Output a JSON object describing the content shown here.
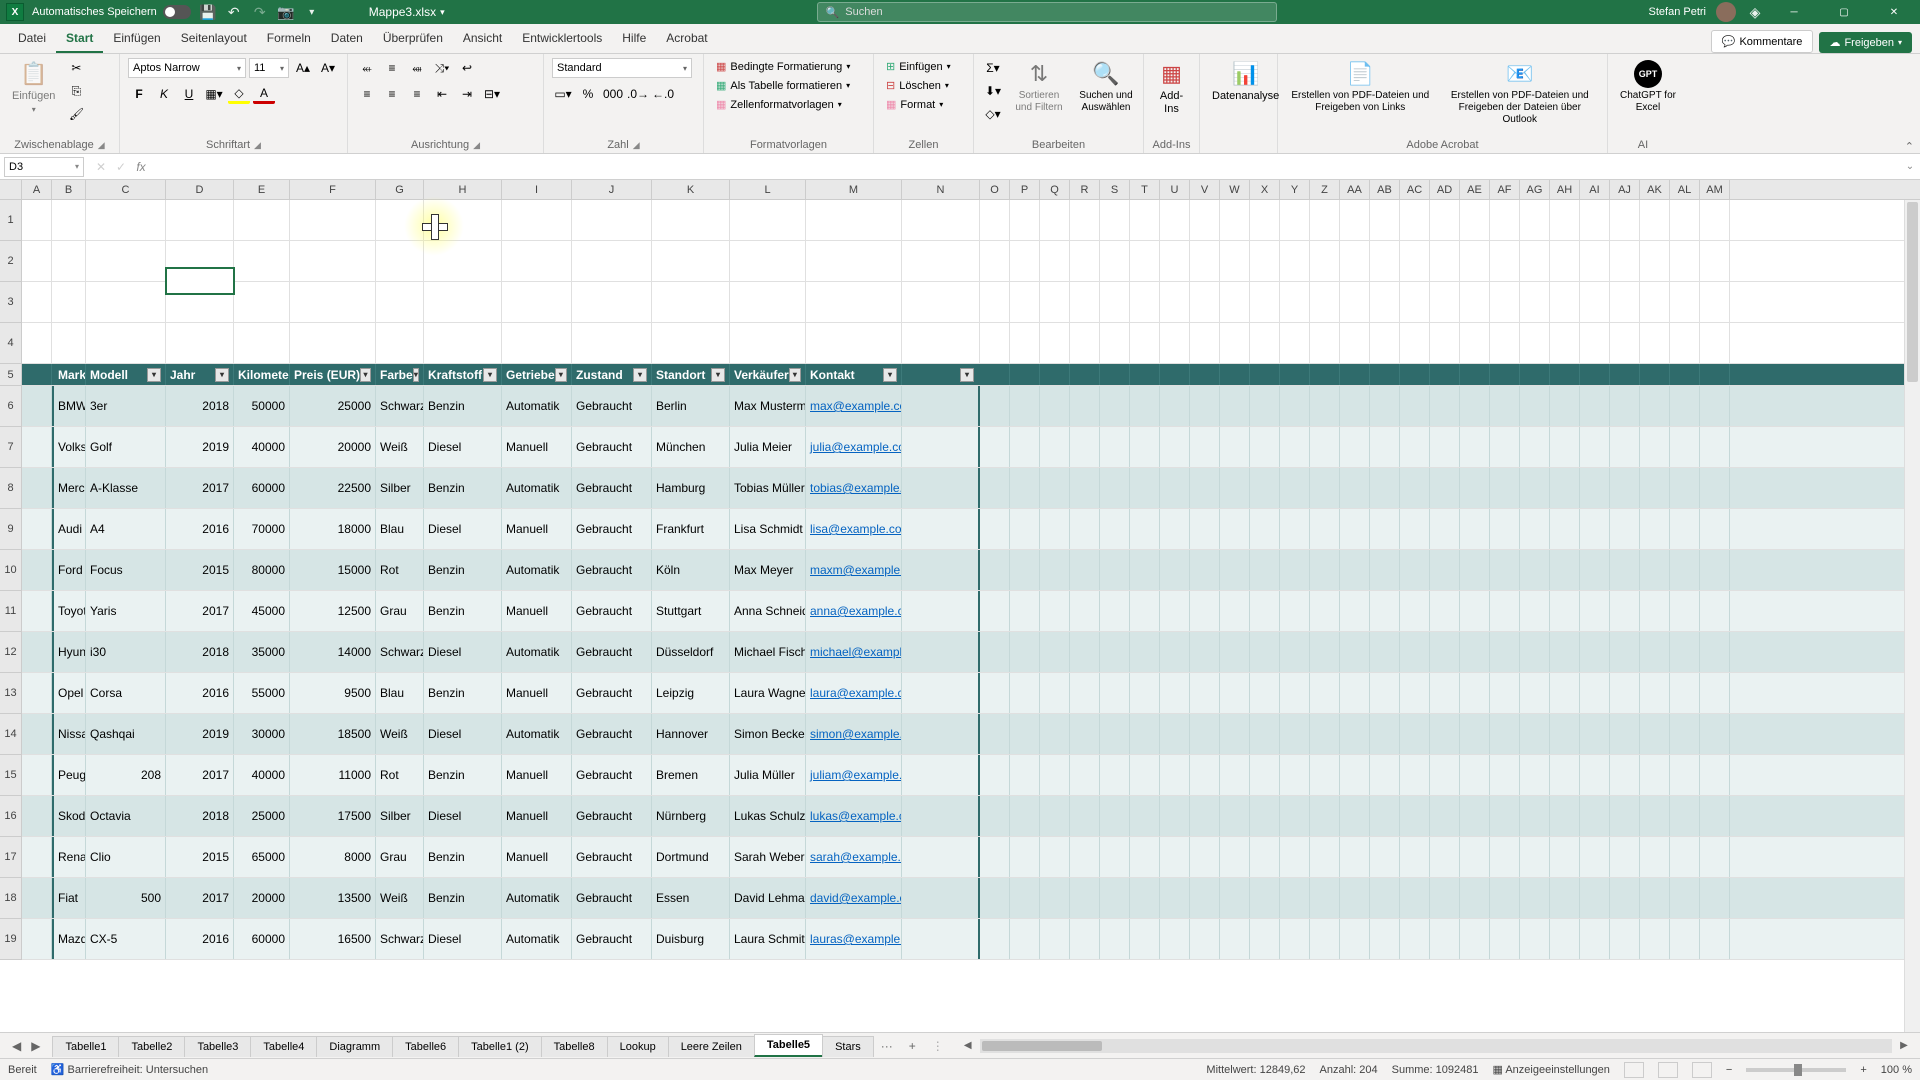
{
  "titlebar": {
    "autosave_label": "Automatisches Speichern",
    "filename": "Mappe3.xlsx",
    "search_placeholder": "Suchen",
    "username": "Stefan Petri"
  },
  "menu": {
    "tabs": [
      "Datei",
      "Start",
      "Einfügen",
      "Seitenlayout",
      "Formeln",
      "Daten",
      "Überprüfen",
      "Ansicht",
      "Entwicklertools",
      "Hilfe",
      "Acrobat"
    ],
    "active": "Start",
    "comments": "Kommentare",
    "share": "Freigeben"
  },
  "ribbon": {
    "clipboard": {
      "paste": "Einfügen",
      "label": "Zwischenablage"
    },
    "font": {
      "name": "Aptos Narrow",
      "size": "11",
      "label": "Schriftart"
    },
    "align": {
      "label": "Ausrichtung"
    },
    "number": {
      "format": "Standard",
      "label": "Zahl"
    },
    "styles": {
      "cond": "Bedingte Formatierung",
      "as_table": "Als Tabelle formatieren",
      "cell_styles": "Zellenformatvorlagen",
      "label": "Formatvorlagen"
    },
    "cells": {
      "insert": "Einfügen",
      "delete": "Löschen",
      "format": "Format",
      "label": "Zellen"
    },
    "editing": {
      "sort": "Sortieren und Filtern",
      "find": "Suchen und Auswählen",
      "label": "Bearbeiten"
    },
    "addins": {
      "btn": "Add-Ins",
      "label": "Add-Ins"
    },
    "analysis": {
      "btn": "Datenanalyse"
    },
    "acrobat": {
      "pdf1": "Erstellen von PDF-Dateien und Freigeben von Links",
      "pdf2": "Erstellen von PDF-Dateien und Freigeben der Dateien über Outlook",
      "label": "Adobe Acrobat"
    },
    "ai": {
      "gpt": "ChatGPT for Excel",
      "label": "AI"
    }
  },
  "formula": {
    "namebox": "D3"
  },
  "columns": [
    "A",
    "B",
    "C",
    "D",
    "E",
    "F",
    "G",
    "H",
    "I",
    "J",
    "K",
    "L",
    "M",
    "N",
    "O",
    "P",
    "Q",
    "R",
    "S",
    "T",
    "U",
    "V",
    "W",
    "X",
    "Y",
    "Z",
    "AA",
    "AB",
    "AC",
    "AD",
    "AE",
    "AF",
    "AG",
    "AH",
    "AI",
    "AJ",
    "AK",
    "AL",
    "AM"
  ],
  "table": {
    "headers": [
      "Marke",
      "Modell",
      "Jahr",
      "Kilometerstand",
      "Preis (EUR)",
      "Farbe",
      "Kraftstoff",
      "Getriebe",
      "Zustand",
      "Standort",
      "Verkäufer",
      "Kontakt"
    ],
    "rows": [
      [
        "BMW",
        "3er",
        "2018",
        "50000",
        "25000",
        "Schwarz",
        "Benzin",
        "Automatik",
        "Gebraucht",
        "Berlin",
        "Max Mustermann",
        "max@example.com"
      ],
      [
        "Volkswagen",
        "Golf",
        "2019",
        "40000",
        "20000",
        "Weiß",
        "Diesel",
        "Manuell",
        "Gebraucht",
        "München",
        "Julia Meier",
        "julia@example.com"
      ],
      [
        "Mercedes",
        "A-Klasse",
        "2017",
        "60000",
        "22500",
        "Silber",
        "Benzin",
        "Automatik",
        "Gebraucht",
        "Hamburg",
        "Tobias Müller",
        "tobias@example.com"
      ],
      [
        "Audi",
        "A4",
        "2016",
        "70000",
        "18000",
        "Blau",
        "Diesel",
        "Manuell",
        "Gebraucht",
        "Frankfurt",
        "Lisa Schmidt",
        "lisa@example.com"
      ],
      [
        "Ford",
        "Focus",
        "2015",
        "80000",
        "15000",
        "Rot",
        "Benzin",
        "Automatik",
        "Gebraucht",
        "Köln",
        "Max Meyer",
        "maxm@example.com"
      ],
      [
        "Toyota",
        "Yaris",
        "2017",
        "45000",
        "12500",
        "Grau",
        "Benzin",
        "Manuell",
        "Gebraucht",
        "Stuttgart",
        "Anna Schneider",
        "anna@example.com"
      ],
      [
        "Hyundai",
        "i30",
        "2018",
        "35000",
        "14000",
        "Schwarz",
        "Diesel",
        "Automatik",
        "Gebraucht",
        "Düsseldorf",
        "Michael Fischer",
        "michael@example.com"
      ],
      [
        "Opel",
        "Corsa",
        "2016",
        "55000",
        "9500",
        "Blau",
        "Benzin",
        "Manuell",
        "Gebraucht",
        "Leipzig",
        "Laura Wagner",
        "laura@example.com"
      ],
      [
        "Nissan",
        "Qashqai",
        "2019",
        "30000",
        "18500",
        "Weiß",
        "Diesel",
        "Automatik",
        "Gebraucht",
        "Hannover",
        "Simon Becker",
        "simon@example.com"
      ],
      [
        "Peugeot",
        "208",
        "2017",
        "40000",
        "11000",
        "Rot",
        "Benzin",
        "Manuell",
        "Gebraucht",
        "Bremen",
        "Julia Müller",
        "juliam@example.com"
      ],
      [
        "Skoda",
        "Octavia",
        "2018",
        "25000",
        "17500",
        "Silber",
        "Diesel",
        "Manuell",
        "Gebraucht",
        "Nürnberg",
        "Lukas Schulz",
        "lukas@example.com"
      ],
      [
        "Renault",
        "Clio",
        "2015",
        "65000",
        "8000",
        "Grau",
        "Benzin",
        "Manuell",
        "Gebraucht",
        "Dortmund",
        "Sarah Weber",
        "sarah@example.com"
      ],
      [
        "Fiat",
        "500",
        "2017",
        "20000",
        "13500",
        "Weiß",
        "Benzin",
        "Automatik",
        "Gebraucht",
        "Essen",
        "David Lehmann",
        "david@example.com"
      ],
      [
        "Mazda",
        "CX-5",
        "2016",
        "60000",
        "16500",
        "Schwarz",
        "Diesel",
        "Automatik",
        "Gebraucht",
        "Duisburg",
        "Laura Schmitz",
        "lauras@example.com"
      ]
    ]
  },
  "sheets": {
    "tabs": [
      "Tabelle1",
      "Tabelle2",
      "Tabelle3",
      "Tabelle4",
      "Diagramm",
      "Tabelle6",
      "Tabelle1 (2)",
      "Tabelle8",
      "Lookup",
      "Leere Zeilen",
      "Tabelle5",
      "Stars"
    ],
    "active": "Tabelle5",
    "more": "···"
  },
  "status": {
    "ready": "Bereit",
    "access": "Barrierefreiheit: Untersuchen",
    "avg_label": "Mittelwert:",
    "avg": "12849,62",
    "count_label": "Anzahl:",
    "count": "204",
    "sum_label": "Summe:",
    "sum": "1092481",
    "display": "Anzeigeeinstellungen",
    "zoom": "100 %"
  }
}
